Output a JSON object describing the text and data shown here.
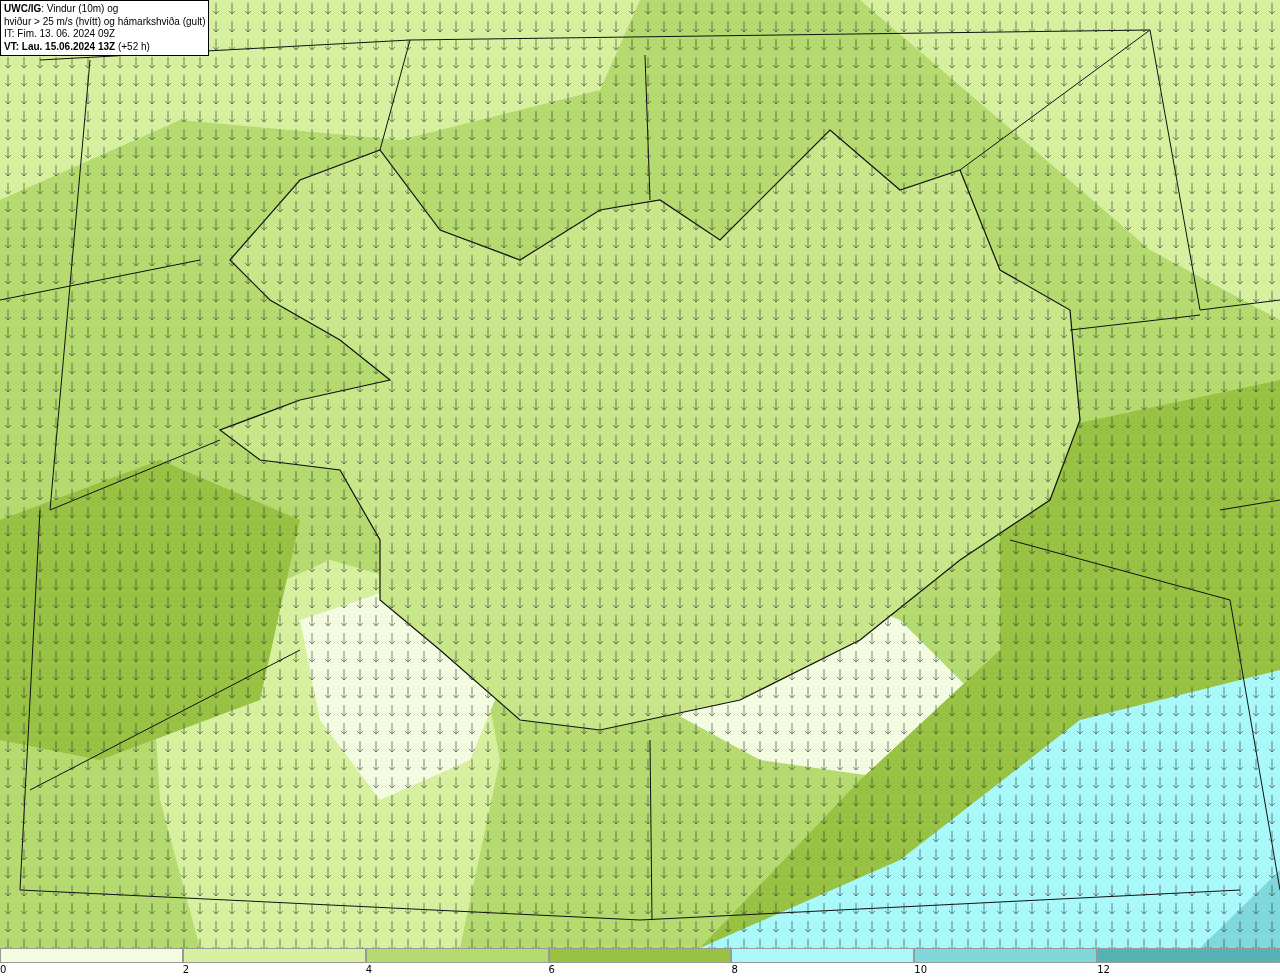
{
  "title_box": {
    "lines": [
      "**UWC/IG**: Vindur (10m) og",
      "hviður > 25 m/s (hvítt) og hámarkshviða (gult)",
      "IT: Fim. 13. 06. 2024 09Z",
      "**VT: Lau. 15.06.2024 13Z** (+52 h)"
    ]
  },
  "colorbar": {
    "segments": [
      {
        "label": "0",
        "color": "#f3fbe1"
      },
      {
        "label": "2",
        "color": "#d6f0a0"
      },
      {
        "label": "4",
        "color": "#b5da70"
      },
      {
        "label": "6",
        "color": "#97c244"
      },
      {
        "label": "8",
        "color": "#a9f9fb"
      },
      {
        "label": "10",
        "color": "#7fd9dc"
      },
      {
        "label": "12",
        "color": "#55b3b6"
      }
    ]
  }
}
